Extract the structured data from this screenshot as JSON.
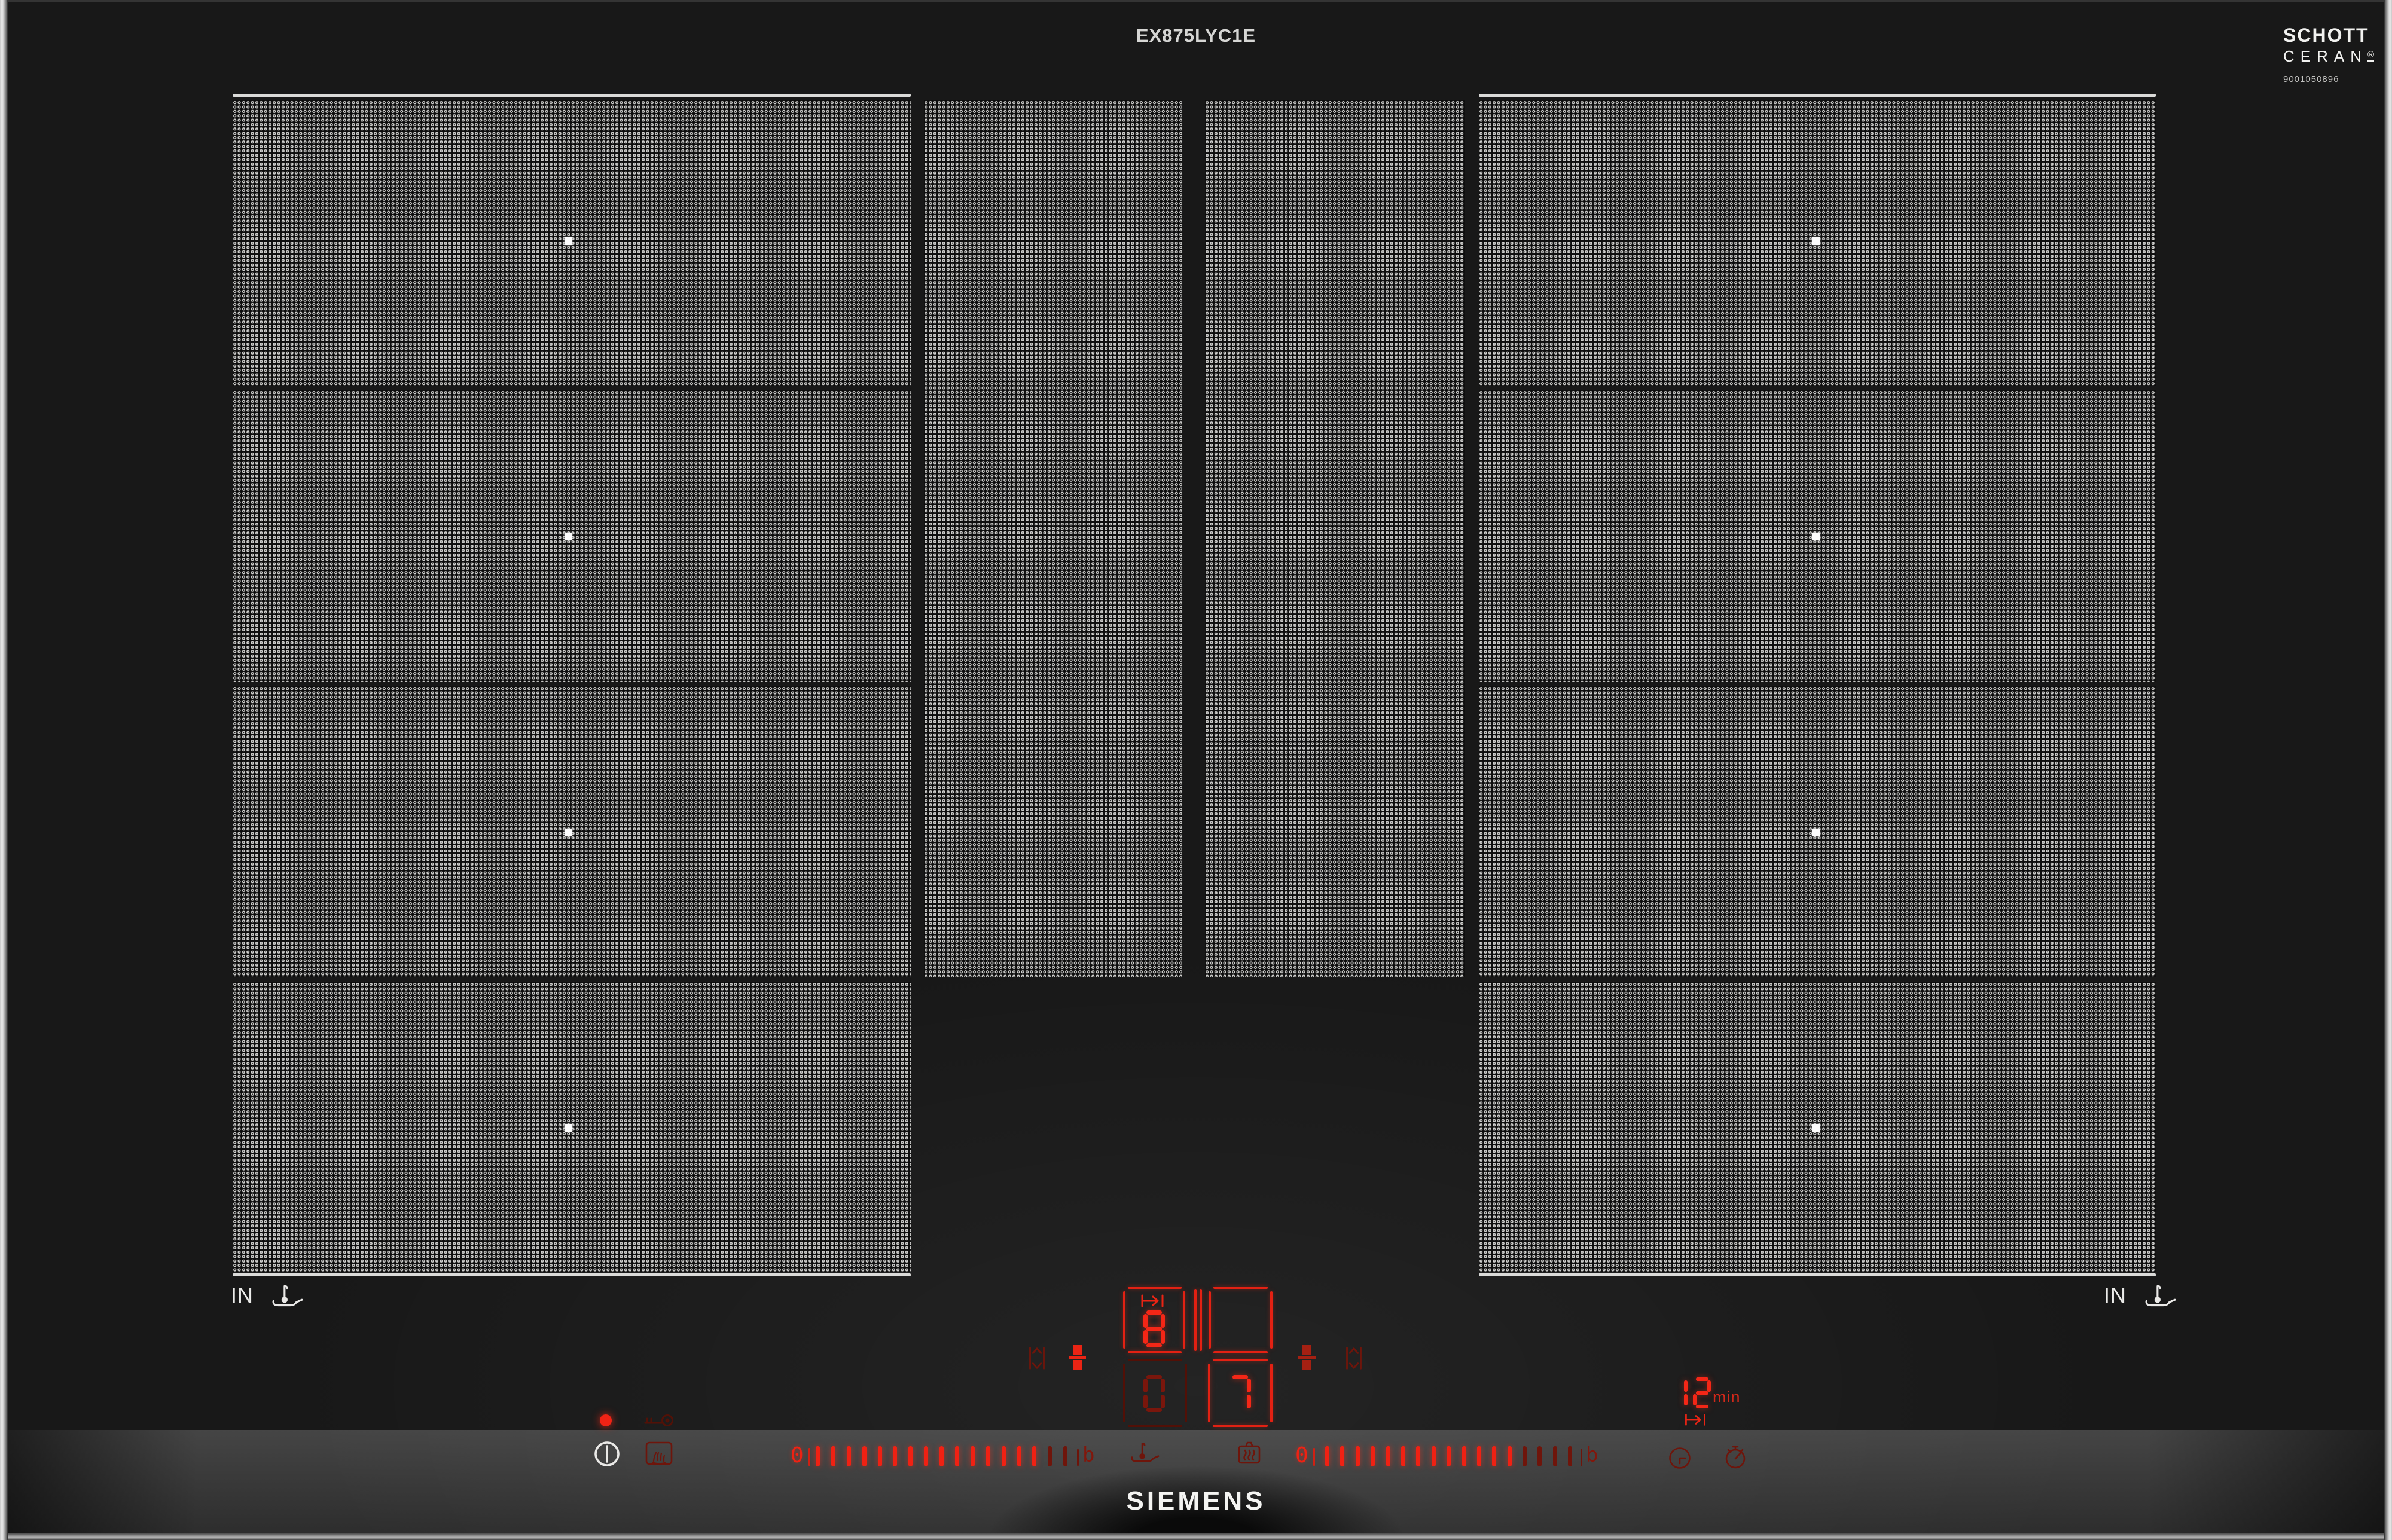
{
  "labels": {
    "model_number": "EX875LYC1E",
    "brand_logo": "SIEMENS"
  },
  "ceran": {
    "brand": "SCHOTT",
    "product": "CERAN",
    "registered_mark": "®",
    "approval_number": "9001050896"
  },
  "zones": {
    "left_induction_label": "IN",
    "right_induction_label": "IN",
    "left_marker_rows": 4,
    "right_marker_rows": 4
  },
  "controls": {
    "status_led": "on",
    "left_slider": {
      "zero_label": "0",
      "boost_label": "b",
      "tick_count": 17,
      "lit_count": 15
    },
    "right_slider": {
      "zero_label": "0",
      "boost_label": "b",
      "tick_count": 17,
      "lit_count": 13
    },
    "level_displays": {
      "left_rear": "8",
      "left_front": "0",
      "right_rear": "",
      "right_front": "7"
    },
    "timer": {
      "value": "12",
      "unit_label": "min"
    }
  },
  "icons": {
    "power": "power-icon",
    "child_lock": "key-icon",
    "wipe_protection": "hand-wipe-icon",
    "frying_sensor": "pan-thermometer-icon",
    "cooking_sensor": "pot-steam-icon",
    "clock": "clock-icon",
    "kitchen_timer": "stopwatch-icon",
    "move_pot": "move-vertical-icon",
    "transfer_zone": "stacked-squares-icon",
    "move_right": "arrow-to-bar-icon",
    "pan_sensor_white": "pan-thermometer-icon"
  },
  "colors": {
    "glass": "#181818",
    "dot_print": "#d4d4d2",
    "led_bright": "#f42717",
    "led_dim": "#7a160c",
    "bezel": "#bdbdbd",
    "logo_white": "#f4f4f2"
  }
}
